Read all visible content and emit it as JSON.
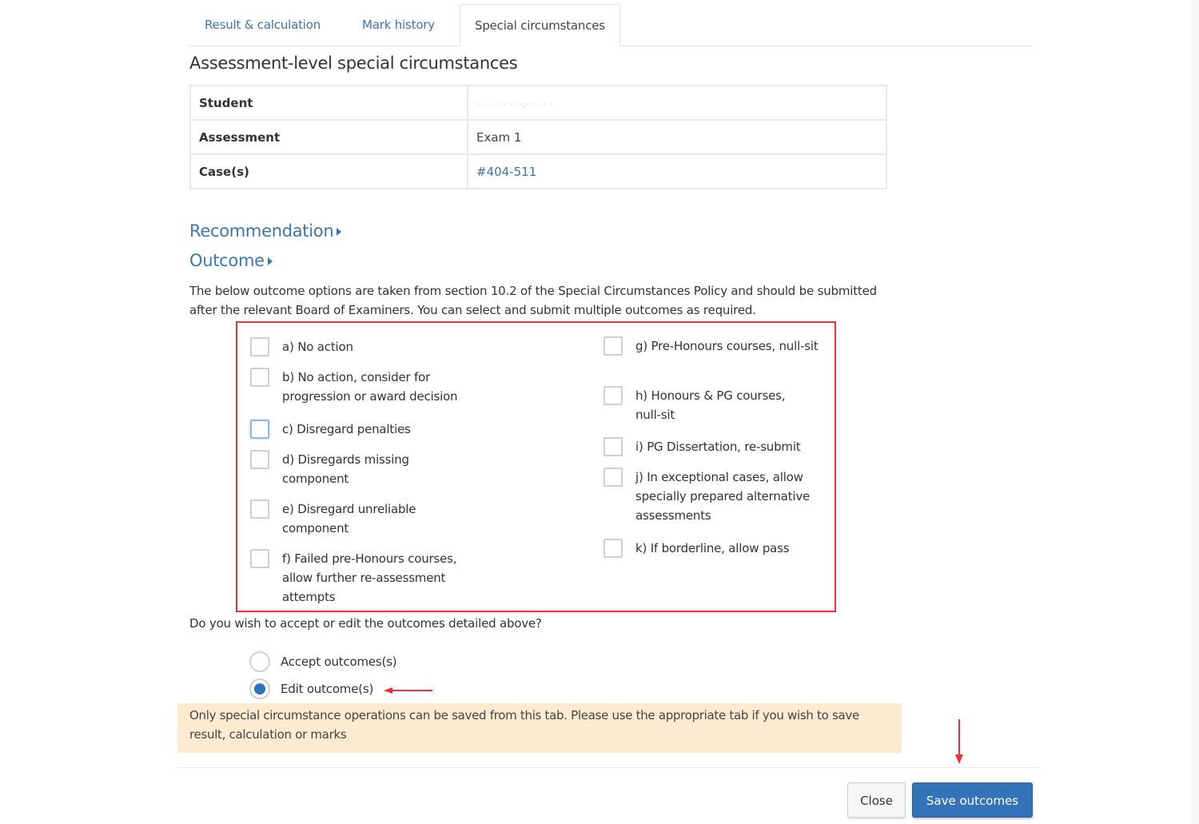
{
  "tabs": [
    {
      "label": "Result & calculation",
      "active": false
    },
    {
      "label": "Mark history",
      "active": false
    },
    {
      "label": "Special circumstances",
      "active": true
    }
  ],
  "section_title": "Assessment-level special circumstances",
  "info_table": {
    "rows": [
      {
        "label": "Student",
        "value": "[redacted]"
      },
      {
        "label": "Assessment",
        "value": "Exam 1"
      },
      {
        "label": "Case(s)",
        "value": "#404-511"
      }
    ]
  },
  "collapsibles": {
    "recommendation": "Recommendation",
    "outcome": "Outcome"
  },
  "description": "The below outcome options are taken from section 10.2 of the Special Circumstances Policy and should be submitted after the relevant Board of Examiners. You can select and submit multiple outcomes as required.",
  "outcome_options": {
    "left": [
      {
        "label": "a) No action",
        "checked": false
      },
      {
        "label": "b) No action, consider for progression or award decision",
        "checked": false
      },
      {
        "label": "c) Disregard penalties",
        "checked": false,
        "focused": true
      },
      {
        "label": "d) Disregards missing component",
        "checked": false
      },
      {
        "label": "e) Disregard unreliable component",
        "checked": false
      },
      {
        "label": "f) Failed pre-Honours courses, allow further re-assessment attempts",
        "checked": false
      }
    ],
    "right": [
      {
        "label": "g) Pre-Honours courses, null-sit",
        "checked": false
      },
      {
        "label": "h) Honours & PG courses, null-sit",
        "checked": false
      },
      {
        "label": "i) PG Dissertation, re-submit",
        "checked": false
      },
      {
        "label": "j) In exceptional cases, allow specially prepared alternative assessments",
        "checked": false
      },
      {
        "label": "k) If borderline, allow pass",
        "checked": false
      }
    ]
  },
  "question": "Do you wish to accept or edit the outcomes detailed above?",
  "radio_options": [
    {
      "label": "Accept outcomes(s)",
      "checked": false
    },
    {
      "label": "Edit outcome(s)",
      "checked": true
    }
  ],
  "warning": "Only special circumstance operations can be saved from this tab. Please use the appropriate tab if you wish to save result, calculation or marks",
  "buttons": {
    "close": "Close",
    "save": "Save outcomes"
  },
  "colors": {
    "link": "#3a76b4",
    "primary_button": "#3573b9",
    "highlight_border": "#e8323c",
    "warning_bg": "#fcebd0",
    "annotation_arrow": "#e8323c"
  }
}
